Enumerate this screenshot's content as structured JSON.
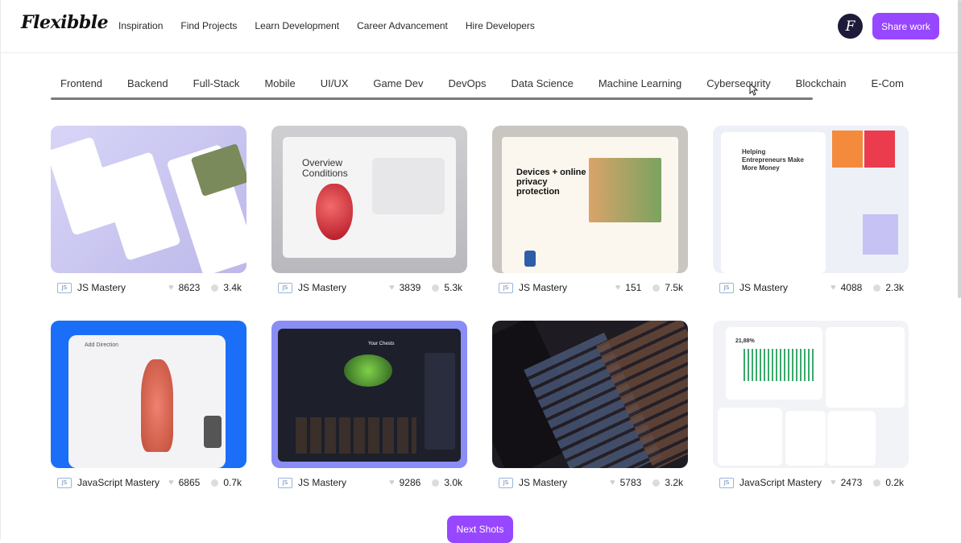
{
  "brand": {
    "logo": "Flexibble"
  },
  "nav": [
    "Inspiration",
    "Find Projects",
    "Learn Development",
    "Career Advancement",
    "Hire Developers"
  ],
  "user": {
    "avatar_letter": "F"
  },
  "share_button": "Share work",
  "categories": [
    "Frontend",
    "Backend",
    "Full-Stack",
    "Mobile",
    "UI/UX",
    "Game Dev",
    "DevOps",
    "Data Science",
    "Machine Learning",
    "Cybersecurity",
    "Blockchain",
    "E-Com"
  ],
  "badge_text": "JS",
  "projects": [
    {
      "author": "JS Mastery",
      "likes": "8623",
      "views": "3.4k",
      "thumb_text": ""
    },
    {
      "author": "JS Mastery",
      "likes": "3839",
      "views": "5.3k",
      "thumb_text": "Overview Conditions"
    },
    {
      "author": "JS Mastery",
      "likes": "151",
      "views": "7.5k",
      "thumb_text": "Devices + online privacy protection"
    },
    {
      "author": "JS Mastery",
      "likes": "4088",
      "views": "2.3k",
      "thumb_text": "Helping Entrepreneurs Make More Money"
    },
    {
      "author": "JavaScript Mastery",
      "likes": "6865",
      "views": "0.7k",
      "thumb_text": "Add Direction"
    },
    {
      "author": "JS Mastery",
      "likes": "9286",
      "views": "3.0k",
      "thumb_text": "Your Chests"
    },
    {
      "author": "JS Mastery",
      "likes": "5783",
      "views": "3.2k",
      "thumb_text": ""
    },
    {
      "author": "JavaScript Mastery",
      "likes": "2473",
      "views": "0.2k",
      "thumb_text": "21,88%"
    }
  ],
  "next_button": "Next Shots"
}
